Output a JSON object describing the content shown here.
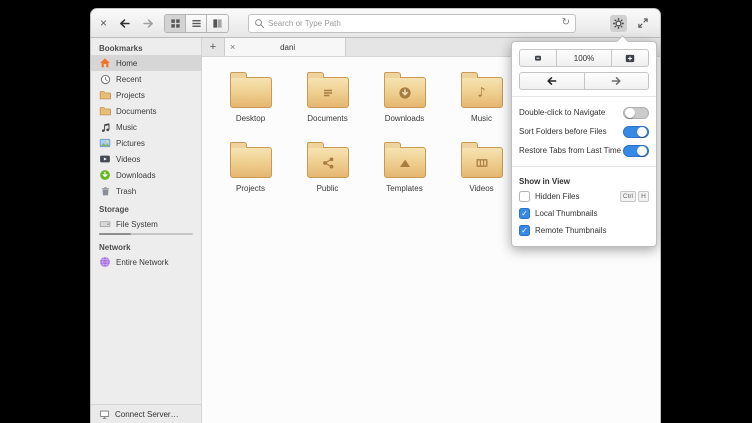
{
  "toolbar": {
    "close_glyph": "×",
    "search_placeholder": "Search or Type Path",
    "refresh_glyph": "↻"
  },
  "tabbar": {
    "new_tab_glyph": "+",
    "tab_close_glyph": "×",
    "tab_title": "dani"
  },
  "sidebar": {
    "sections": [
      {
        "title": "Bookmarks",
        "items": [
          {
            "label": "Home",
            "icon": "home-icon",
            "selected": true
          },
          {
            "label": "Recent",
            "icon": "clock-icon",
            "selected": false
          },
          {
            "label": "Projects",
            "icon": "folder-icon",
            "selected": false
          },
          {
            "label": "Documents",
            "icon": "folder-icon",
            "selected": false
          },
          {
            "label": "Music",
            "icon": "music-note-icon",
            "selected": false
          },
          {
            "label": "Pictures",
            "icon": "picture-icon",
            "selected": false
          },
          {
            "label": "Videos",
            "icon": "video-icon",
            "selected": false
          },
          {
            "label": "Downloads",
            "icon": "download-circle-icon",
            "selected": false
          },
          {
            "label": "Trash",
            "icon": "trash-icon",
            "selected": false
          }
        ]
      },
      {
        "title": "Storage",
        "items": [
          {
            "label": "File System",
            "icon": "harddrive-icon",
            "selected": false
          }
        ]
      },
      {
        "title": "Network",
        "items": [
          {
            "label": "Entire Network",
            "icon": "network-globe-icon",
            "selected": false
          }
        ]
      }
    ],
    "connect_server": "Connect Server…"
  },
  "files": [
    {
      "name": "Desktop",
      "emblem": "none"
    },
    {
      "name": "Documents",
      "emblem": "text-lines"
    },
    {
      "name": "Downloads",
      "emblem": "download-arrow"
    },
    {
      "name": "Music",
      "emblem": "music-note",
      "glyph": "♪"
    },
    {
      "name": "Projects",
      "emblem": "none"
    },
    {
      "name": "Public",
      "emblem": "share-nodes"
    },
    {
      "name": "Templates",
      "emblem": "mountain"
    },
    {
      "name": "Videos",
      "emblem": "filmstrip"
    }
  ],
  "popover": {
    "zoom_level": "100%",
    "toggles": [
      {
        "label": "Double-click to Navigate",
        "on": false
      },
      {
        "label": "Sort Folders before Files",
        "on": true
      },
      {
        "label": "Restore Tabs from Last Time",
        "on": true
      }
    ],
    "section_title": "Show in View",
    "checks": [
      {
        "label": "Hidden Files",
        "checked": false,
        "shortcut": [
          "Ctrl",
          "H"
        ]
      },
      {
        "label": "Local Thumbnails",
        "checked": true
      },
      {
        "label": "Remote Thumbnails",
        "checked": true
      }
    ],
    "check_glyph": "✓"
  },
  "colors": {
    "accent_blue": "#3689e6",
    "folder_tan": "#e9bd77",
    "sidebar_gray": "#ededed"
  }
}
